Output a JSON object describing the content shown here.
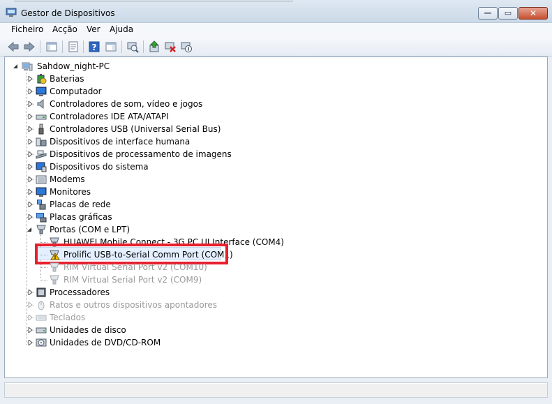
{
  "window": {
    "title": "Gestor de Dispositivos",
    "close_glyph": "✕",
    "restore_glyph": "▭",
    "minimize_glyph": "—"
  },
  "menu": [
    "Ficheiro",
    "Acção",
    "Ver",
    "Ajuda"
  ],
  "toolbar_icons": [
    "back-arrow-icon",
    "forward-arrow-icon",
    "show-hide-console-tree-icon",
    "properties-icon",
    "help-icon",
    "show-action-pane-icon",
    "scan-hardware-icon",
    "update-driver-icon",
    "uninstall-icon",
    "disable-icon"
  ],
  "tree": {
    "root": "Sahdow_night-PC",
    "items": [
      "Baterias",
      "Computador",
      "Controladores de som, vídeo e jogos",
      "Controladores IDE ATA/ATAPI",
      "Controladores USB (Universal Serial Bus)",
      "Dispositivos de interface humana",
      "Dispositivos de processamento de imagens",
      "Dispositivos do sistema",
      "Modems",
      "Monitores",
      "Placas de rede",
      "Placas gráficas",
      "Portas (COM e LPT)"
    ],
    "ports_children": [
      "HUAWEI Mobile Connect - 3G PC UI Interface (COM4)",
      "Prolific USB-to-Serial Comm Port (COM1)",
      "RIM Virtual Serial Port v2 (COM10)",
      "RIM Virtual Serial Port v2 (COM9)"
    ],
    "items_after": [
      "Processadores",
      "Ratos e outros dispositivos apontadores",
      "Teclados",
      "Unidades de disco",
      "Unidades de DVD/CD-ROM"
    ]
  },
  "colors": {
    "highlight": "#e8202e",
    "warning": "#f2c200",
    "selection": "#e4efff"
  }
}
